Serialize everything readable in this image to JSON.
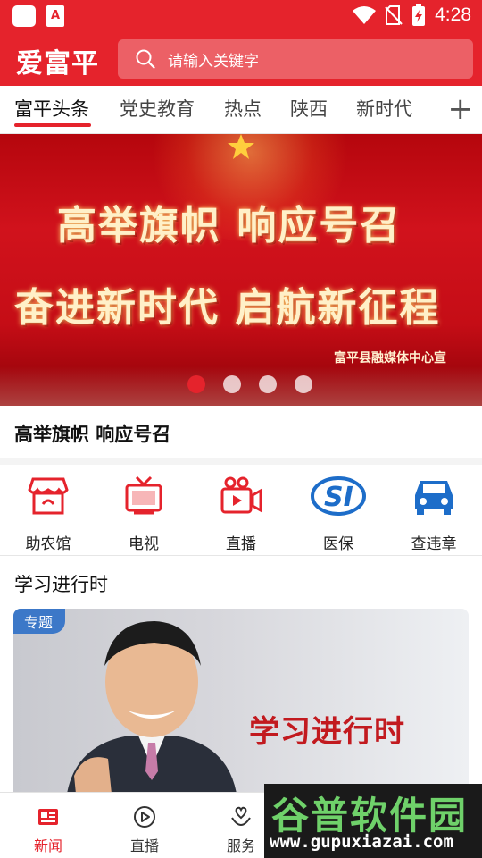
{
  "status_bar": {
    "time": "4:28",
    "app_badge": "A"
  },
  "header": {
    "logo": "爱富平",
    "search_placeholder": "请输入关键字"
  },
  "tabs": [
    {
      "label": "富平头条",
      "active": true
    },
    {
      "label": "党史教育"
    },
    {
      "label": "热点"
    },
    {
      "label": "陕西"
    },
    {
      "label": "新时代"
    }
  ],
  "banner": {
    "line1": "高举旗帜  响应号召",
    "line2": "奋进新时代  启航新征程",
    "credit": "富平县融媒体中心宣",
    "slide_count": 4,
    "active_slide": 1
  },
  "caption": "高举旗帜 响应号召",
  "services": [
    {
      "label": "助农馆",
      "icon": "storefront-icon"
    },
    {
      "label": "电视",
      "icon": "tv-icon"
    },
    {
      "label": "直播",
      "icon": "video-camera-icon"
    },
    {
      "label": "医保",
      "icon": "social-insurance-icon"
    },
    {
      "label": "查违章",
      "icon": "car-icon"
    }
  ],
  "section": {
    "title": "学习进行时",
    "badge": "专题",
    "feature_title": "学习进行时"
  },
  "bottom_nav": [
    {
      "label": "新闻",
      "icon": "news-icon",
      "active": true
    },
    {
      "label": "直播",
      "icon": "play-icon"
    },
    {
      "label": "服务",
      "icon": "heart-hand-icon"
    }
  ],
  "watermark": {
    "title": "谷普软件园",
    "url": "www.gupuxiazai.com"
  },
  "colors": {
    "brand_red": "#e5232c",
    "badge_blue": "#3c78c8",
    "watermark_green": "#6fd16a"
  }
}
